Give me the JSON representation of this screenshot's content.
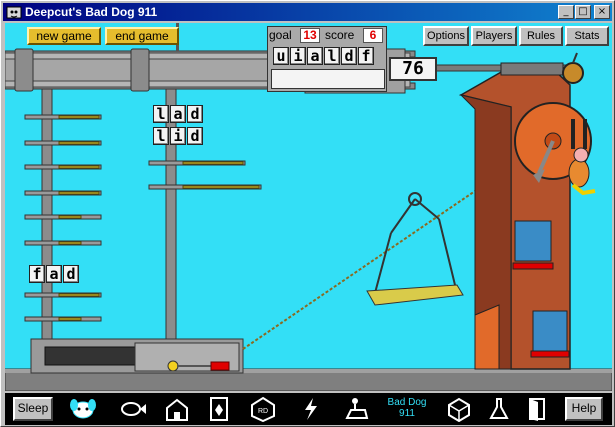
{
  "window": {
    "title": "Deepcut's Bad Dog 911",
    "minimize": "_",
    "maximize": "□",
    "close": "×"
  },
  "top_controls": {
    "new_game": "new game",
    "end_game": "end game",
    "goal_label": "goal",
    "goal_value": "13",
    "score_label": "score",
    "score_value": "6"
  },
  "nav": {
    "options": "Options",
    "players": "Players",
    "rules": "Rules",
    "stats": "Stats"
  },
  "letters_available": [
    "u",
    "i",
    "a",
    "l",
    "d",
    "f"
  ],
  "word_entry": "",
  "timer": "76",
  "found_words": [
    [
      "l",
      "a",
      "d"
    ],
    [
      "l",
      "i",
      "d"
    ]
  ],
  "word_left": [
    "f",
    "a",
    "d"
  ],
  "toolbar": {
    "sleep": "Sleep",
    "help": "Help",
    "center_label_1": "Bad Dog",
    "center_label_2": "911",
    "icons": [
      "dog-face-icon",
      "fish-icon",
      "schoolhouse-icon",
      "playing-card-icon",
      "rd-badge-icon",
      "lightning-icon",
      "runner-icon",
      "cube-icon",
      "chemistry-icon",
      "door-icon"
    ]
  },
  "colors": {
    "sky": "#33dff6",
    "crane_gray": "#9c9c9c",
    "brick": "#b4522c",
    "gold": "#e5bd2d",
    "orange_wheel": "#e16a2a"
  }
}
